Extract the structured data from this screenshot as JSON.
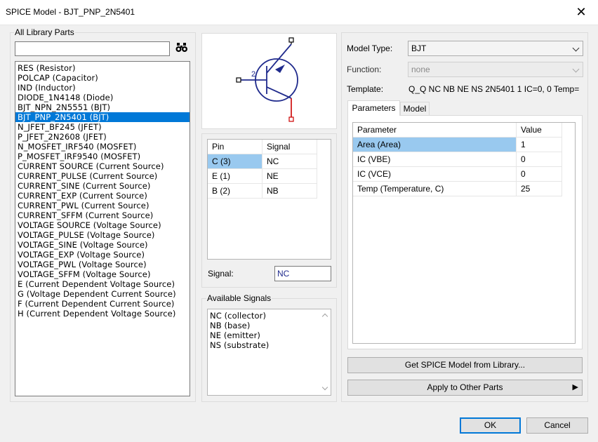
{
  "window": {
    "title": "SPICE Model - BJT_PNP_2N5401",
    "close_glyph": "✕"
  },
  "library": {
    "group_label": "All Library Parts",
    "search_value": "",
    "items": [
      "RES (Resistor)",
      "POLCAP (Capacitor)",
      "IND (Inductor)",
      "DIODE_1N4148 (Diode)",
      "BJT_NPN_2N5551 (BJT)",
      "BJT_PNP_2N5401 (BJT)",
      "N_JFET_BF245 (JFET)",
      "P_JFET_2N2608 (JFET)",
      "N_MOSFET_IRF540 (MOSFET)",
      "P_MOSFET_IRF9540 (MOSFET)",
      "CURRENT SOURCE (Current Source)",
      "CURRENT_PULSE (Current Source)",
      "CURRENT_SINE (Current Source)",
      "CURRENT_EXP (Current Source)",
      "CURRENT_PWL (Current Source)",
      "CURRENT_SFFM (Current Source)",
      "VOLTAGE SOURCE (Voltage Source)",
      "VOLTAGE_PULSE (Voltage Source)",
      "VOLTAGE_SINE (Voltage Source)",
      "VOLTAGE_EXP (Voltage Source)",
      "VOLTAGE_PWL (Voltage Source)",
      "VOLTAGE_SFFM (Voltage Source)",
      "E (Current Dependent Voltage Source)",
      "G (Voltage Dependent Current Source)",
      "F (Current Dependent Current Source)",
      "H (Current Dependent Voltage Source)"
    ],
    "selected_index": 5
  },
  "symbol": {
    "pin_label": "2"
  },
  "pins": {
    "headers": [
      "Pin",
      "Signal"
    ],
    "rows": [
      {
        "pin": "C (3)",
        "signal": "NC"
      },
      {
        "pin": "E (1)",
        "signal": "NE"
      },
      {
        "pin": "B (2)",
        "signal": "NB"
      }
    ],
    "signal_label": "Signal:",
    "signal_value": "NC"
  },
  "available_signals": {
    "group_label": "Available Signals",
    "items": [
      "NC (collector)",
      "NB (base)",
      "NE (emitter)",
      "NS (substrate)"
    ]
  },
  "model": {
    "model_type_label": "Model Type:",
    "model_type_value": "BJT",
    "function_label": "Function:",
    "function_value": "none",
    "template_label": "Template:",
    "template_value": "Q_Q NC NB NE NS 2N5401 1 IC=0, 0 Temp="
  },
  "tabs": [
    "Parameters",
    "Model"
  ],
  "params": {
    "headers": [
      "Parameter",
      "Value"
    ],
    "rows": [
      {
        "name": "Area (Area)",
        "value": "1"
      },
      {
        "name": "IC (VBE)",
        "value": "0"
      },
      {
        "name": "IC (VCE)",
        "value": "0"
      },
      {
        "name": "Temp (Temperature, C)",
        "value": "25"
      }
    ]
  },
  "buttons": {
    "get_model": "Get SPICE Model from Library...",
    "apply_other": "Apply to Other Parts",
    "apply_arrow": "▶",
    "ok": "OK",
    "cancel": "Cancel"
  },
  "colors": {
    "selection": "#0078d7",
    "cell_selection": "#99c9ef",
    "symbol_blue": "#1f2a8c",
    "symbol_red": "#cc0000"
  }
}
